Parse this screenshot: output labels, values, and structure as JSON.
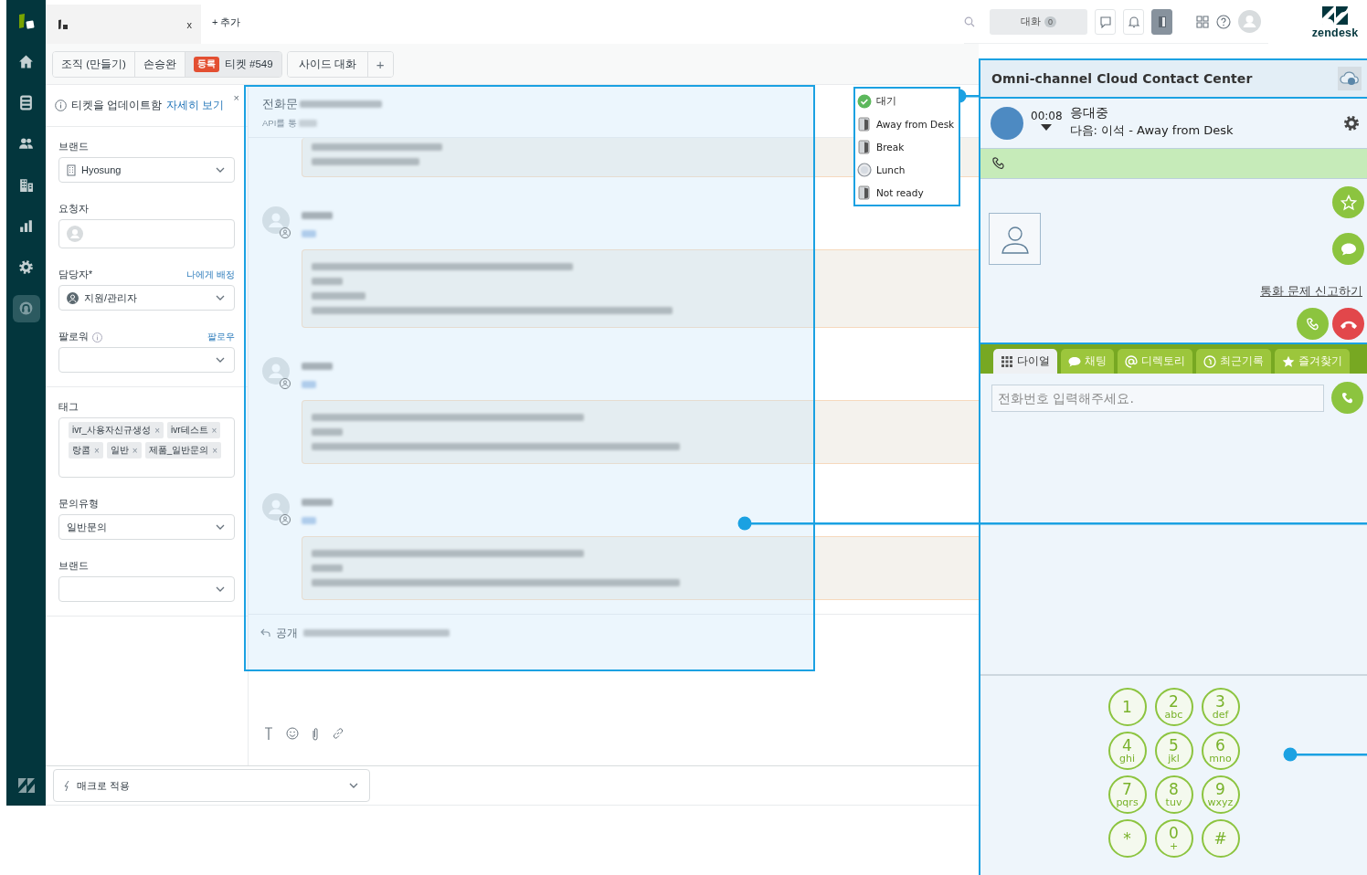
{
  "sidebar": {
    "items": [
      {
        "kind": "home",
        "selected": false
      },
      {
        "kind": "views",
        "selected": false
      },
      {
        "kind": "customers",
        "selected": false
      },
      {
        "kind": "organizations",
        "selected": false
      },
      {
        "kind": "reporting",
        "selected": false
      },
      {
        "kind": "admin",
        "selected": false
      },
      {
        "kind": "app",
        "selected": true
      }
    ]
  },
  "topbar": {
    "tab": {
      "close": "x"
    },
    "add": "+ 추가",
    "conversations": {
      "label": "대화",
      "count": "0"
    },
    "brand": "zendesk"
  },
  "subtabs": {
    "items": [
      {
        "label": "조직 (만들기)",
        "selected": false
      },
      {
        "label": "손승완",
        "selected": false
      },
      {
        "label": "티켓 #549",
        "badge": "등록",
        "selected": true
      }
    ],
    "side": {
      "label": "사이드 대화",
      "add": "+"
    }
  },
  "form": {
    "notice": {
      "text": "티켓을 업데이트함",
      "link": "자세히 보기",
      "close": "×"
    },
    "sections": [
      {
        "fields": [
          {
            "kind": "brand",
            "label": "브랜드",
            "value": "Hyosung"
          },
          {
            "kind": "requester",
            "label": "요청자"
          },
          {
            "kind": "assignee",
            "label": "담당자*",
            "action": "나에게 배정",
            "value": "지원/관리자"
          },
          {
            "kind": "followers",
            "label": "팔로워",
            "action": "팔로우"
          }
        ]
      },
      {
        "fields": [
          {
            "kind": "tags",
            "label": "태그",
            "tags": [
              {
                "text": "ivr_사용자신규생성",
                "remove": "×"
              },
              {
                "text": "ivr테스트",
                "remove": "×"
              },
              {
                "text": "랑콤",
                "remove": "×"
              },
              {
                "text": "일반",
                "remove": "×"
              },
              {
                "text": "제품_일반문의",
                "remove": "×"
              }
            ]
          },
          {
            "kind": "select",
            "label": "문의유형",
            "value": "일반문의"
          },
          {
            "kind": "select",
            "label": "브랜드"
          }
        ]
      }
    ]
  },
  "conversation": {
    "title": "전화문",
    "subtitle": "API를 통",
    "messages": [
      {
        "kind": "partial"
      },
      {
        "kind": "call_long"
      },
      {
        "kind": "call"
      },
      {
        "kind": "call"
      }
    ],
    "reply": {
      "mode": "공개"
    }
  },
  "macro": {
    "label": "매크로 적용"
  },
  "status_menu": {
    "items": [
      {
        "label": "대기",
        "kind": "ready"
      },
      {
        "label": "Away from Desk",
        "kind": "away"
      },
      {
        "label": "Break",
        "kind": "break"
      },
      {
        "label": "Lunch",
        "kind": "lunch"
      },
      {
        "label": "Not ready",
        "kind": "notready"
      }
    ]
  },
  "cti": {
    "title": "Omni-channel Cloud Contact Center",
    "timer": "00:08",
    "state": "응대중",
    "next": "다음: 이석 - Away from Desk",
    "report_link": "통화 문제 신고하기",
    "tabs": [
      {
        "label": "다이얼",
        "kind": "dial",
        "selected": true
      },
      {
        "label": "채팅",
        "kind": "chat",
        "selected": false
      },
      {
        "label": "디렉토리",
        "kind": "directory",
        "selected": false
      },
      {
        "label": "최근기록",
        "kind": "recent",
        "selected": false
      },
      {
        "label": "즐겨찾기",
        "kind": "favorites",
        "selected": false
      }
    ],
    "dial": {
      "placeholder": "전화번호 입력해주세요."
    },
    "keypad": [
      {
        "digit": "1"
      },
      {
        "digit": "2",
        "letters": "abc"
      },
      {
        "digit": "3",
        "letters": "def"
      },
      {
        "digit": "4",
        "letters": "ghi"
      },
      {
        "digit": "5",
        "letters": "jkl"
      },
      {
        "digit": "6",
        "letters": "mno"
      },
      {
        "digit": "7",
        "letters": "pqrs"
      },
      {
        "digit": "8",
        "letters": "tuv"
      },
      {
        "digit": "9",
        "letters": "wxyz"
      },
      {
        "digit": "*"
      },
      {
        "digit": "0",
        "letters": "+"
      },
      {
        "digit": "#"
      }
    ]
  }
}
